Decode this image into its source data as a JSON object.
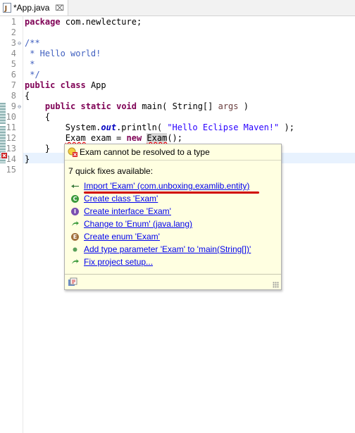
{
  "tab": {
    "title": "*App.java",
    "close": "⌧"
  },
  "lines": [
    {
      "num": "1",
      "fold": "",
      "segs": [
        {
          "t": "package",
          "c": "kw"
        },
        {
          "t": " com.newlecture;",
          "c": ""
        }
      ]
    },
    {
      "num": "2",
      "fold": "",
      "segs": []
    },
    {
      "num": "3",
      "fold": "⊖",
      "segs": [
        {
          "t": "/**",
          "c": "cm"
        }
      ]
    },
    {
      "num": "4",
      "fold": "",
      "segs": [
        {
          "t": " * Hello world!",
          "c": "cm"
        }
      ]
    },
    {
      "num": "5",
      "fold": "",
      "segs": [
        {
          "t": " *",
          "c": "cm"
        }
      ]
    },
    {
      "num": "6",
      "fold": "",
      "segs": [
        {
          "t": " */",
          "c": "cm"
        }
      ]
    },
    {
      "num": "7",
      "fold": "",
      "segs": [
        {
          "t": "public",
          "c": "kw"
        },
        {
          "t": " ",
          "c": ""
        },
        {
          "t": "class",
          "c": "kw"
        },
        {
          "t": " App",
          "c": ""
        }
      ]
    },
    {
      "num": "8",
      "fold": "",
      "segs": [
        {
          "t": "{",
          "c": ""
        }
      ]
    },
    {
      "num": "9",
      "fold": "⊖",
      "segs": [
        {
          "t": "    ",
          "c": ""
        },
        {
          "t": "public",
          "c": "kw"
        },
        {
          "t": " ",
          "c": ""
        },
        {
          "t": "static",
          "c": "kw"
        },
        {
          "t": " ",
          "c": ""
        },
        {
          "t": "void",
          "c": "kw"
        },
        {
          "t": " main( String[] ",
          "c": ""
        },
        {
          "t": "args",
          "c": "param"
        },
        {
          "t": " )",
          "c": ""
        }
      ]
    },
    {
      "num": "10",
      "fold": "",
      "segs": [
        {
          "t": "    {",
          "c": ""
        }
      ]
    },
    {
      "num": "11",
      "fold": "",
      "segs": [
        {
          "t": "        System.",
          "c": ""
        },
        {
          "t": "out",
          "c": "st"
        },
        {
          "t": ".println( ",
          "c": ""
        },
        {
          "t": "\"Hello Eclipse Maven!\"",
          "c": "str"
        },
        {
          "t": " );",
          "c": ""
        }
      ]
    },
    {
      "num": "12",
      "fold": "",
      "segs": [
        {
          "t": "        ",
          "c": ""
        },
        {
          "t": "Exam",
          "c": "err"
        },
        {
          "t": " exam = ",
          "c": ""
        },
        {
          "t": "new",
          "c": "kw"
        },
        {
          "t": " ",
          "c": ""
        },
        {
          "t": "Exam",
          "c": "err selbox"
        },
        {
          "t": "();",
          "c": ""
        }
      ]
    },
    {
      "num": "13",
      "fold": "",
      "segs": [
        {
          "t": "    }",
          "c": ""
        }
      ]
    },
    {
      "num": "14",
      "fold": "",
      "segs": [
        {
          "t": "}",
          "c": ""
        }
      ]
    },
    {
      "num": "15",
      "fold": "",
      "segs": []
    }
  ],
  "popup": {
    "error": "Exam cannot be resolved to a type",
    "count": "7 quick fixes available:",
    "fixes": [
      {
        "label": "Import 'Exam' (com.unboxing.examlib.entity)",
        "icon": "import-icon"
      },
      {
        "label": "Create class 'Exam'",
        "icon": "class-icon",
        "letter": "C",
        "color": "#3c9a3c"
      },
      {
        "label": "Create interface 'Exam'",
        "icon": "interface-icon",
        "letter": "I",
        "color": "#7a4fb0"
      },
      {
        "label": "Change to 'Enum' (java.lang)",
        "icon": "change-icon"
      },
      {
        "label": "Create enum 'Exam'",
        "icon": "enum-icon",
        "letter": "E",
        "color": "#a0703c"
      },
      {
        "label": "Add type parameter 'Exam' to 'main(String[])'",
        "icon": "type-param-icon"
      },
      {
        "label": "Fix project setup...",
        "icon": "setup-icon"
      }
    ]
  },
  "colors": {
    "annotation": "#d00000",
    "keyword": "#7f0055",
    "comment": "#3f5fbf",
    "string": "#2a00ff"
  }
}
